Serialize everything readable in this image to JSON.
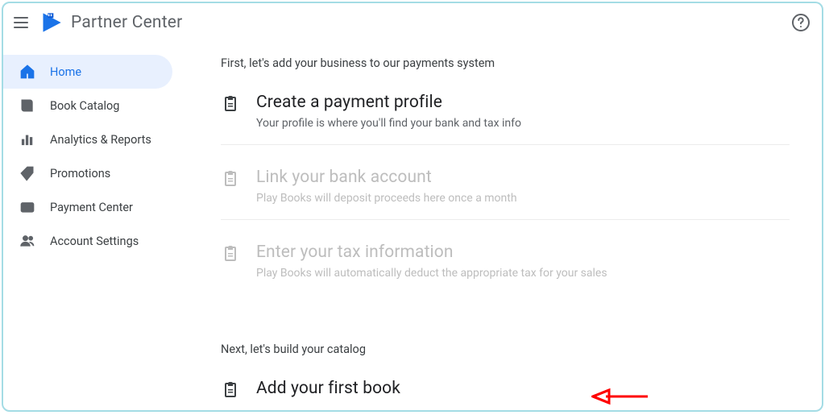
{
  "header": {
    "title": "Partner Center"
  },
  "sidebar": {
    "items": [
      {
        "label": "Home"
      },
      {
        "label": "Book Catalog"
      },
      {
        "label": "Analytics & Reports"
      },
      {
        "label": "Promotions"
      },
      {
        "label": "Payment Center"
      },
      {
        "label": "Account Settings"
      }
    ]
  },
  "content": {
    "section1_intro": "First, let's add your business to our payments system",
    "steps": [
      {
        "title": "Create a payment profile",
        "desc": "Your profile is where you'll find your bank and tax info"
      },
      {
        "title": "Link your bank account",
        "desc": "Play Books will deposit proceeds here once a month"
      },
      {
        "title": "Enter your tax information",
        "desc": "Play Books will automatically deduct the appropriate tax for your sales"
      }
    ],
    "section2_intro": "Next, let's build your catalog",
    "step4": {
      "title": "Add your first book"
    }
  }
}
